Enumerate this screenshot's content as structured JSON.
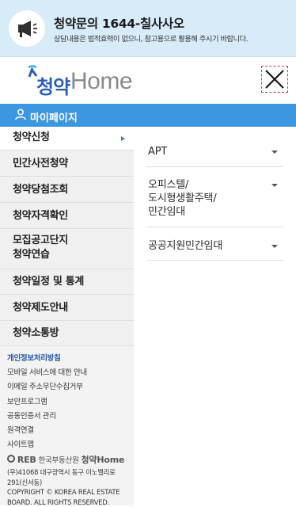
{
  "banner": {
    "title": "청약문의 1644-칠사사오",
    "description": "상담내용은 법적효력이 없으니, 참고용으로 활용해 주시기 바랍니다."
  },
  "header": {
    "logo_hangul": "청약",
    "logo_home": "Home"
  },
  "mypage": {
    "label": "마이페이지"
  },
  "leftnav": [
    {
      "label": "청약신청",
      "active": true
    },
    {
      "label": "민간사전청약"
    },
    {
      "label": "청약당첨조회"
    },
    {
      "label": "청약자격확인"
    },
    {
      "label_line1": "모집공고단지",
      "label_line2": "청약연습"
    },
    {
      "label": "청약일정 및 통계"
    },
    {
      "label": "청약제도안내"
    },
    {
      "label": "청약소통방"
    }
  ],
  "links": [
    "개인정보처리방침",
    "모바일 서비스에 대한 안내",
    "이메일 주소무단수집거부",
    "보안프로그램",
    "공동인증서 관리",
    "원격연결",
    "사이트맵"
  ],
  "footer": {
    "brand_reb": "REB",
    "brand_org": "한국부동산원",
    "brand_site": "청약Home",
    "address": "(우)41068 대구광역시 동구 이노밸리로 291(신서동)",
    "copyright": "COPYRIGHT © KOREA REAL ESTATE BOARD. ALL RIGHTS RESERVED."
  },
  "submenu": [
    {
      "label": "APT"
    },
    {
      "line1": "오피스텔/",
      "line2": "도시형생활주택/",
      "line3": "민간임대"
    },
    {
      "label": "공공지원민간임대"
    }
  ],
  "colors": {
    "banner_bg": "#d7ebf9",
    "mypage_bar": "#3d96e0",
    "logo_blue": "#2b5fb6",
    "close_outline": "#c9383a"
  },
  "icons": [
    "megaphone-icon",
    "close-icon",
    "user-icon",
    "chevron-right-icon",
    "chevron-down-icon"
  ]
}
